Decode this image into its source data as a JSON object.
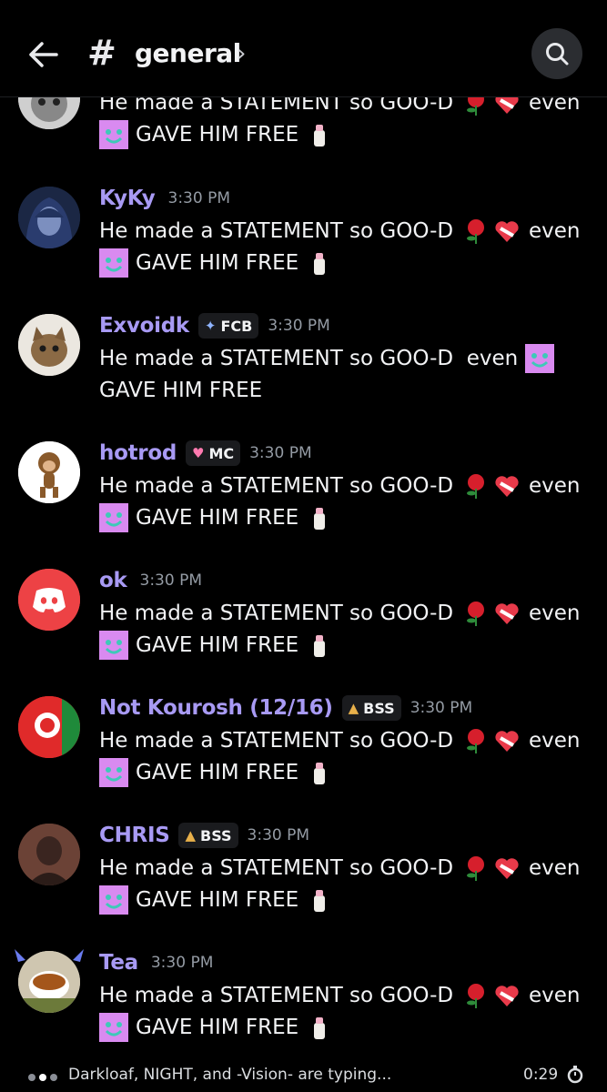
{
  "header": {
    "channel_name": "general",
    "hash": "#",
    "chevron": "›",
    "icons": [
      "back-arrow-icon",
      "search-icon"
    ]
  },
  "message_text": {
    "line1": "He made a STATEMENT so GOO-D",
    "even": "even",
    "line2": "GAVE HIM FREE",
    "alt_line1": "He made a STATEMENT so GOO-D  even",
    "alt_line2": "GAVE HIM FREE"
  },
  "messages": [
    {
      "username": "",
      "tag": "",
      "time": ""
    },
    {
      "username": "KyKy",
      "tag": "",
      "time": "3:30 PM"
    },
    {
      "username": "Exvoidk",
      "tag": "FCB",
      "time": "3:30 PM"
    },
    {
      "username": "hotrod",
      "tag": "MC",
      "time": "3:30 PM"
    },
    {
      "username": "ok",
      "tag": "",
      "time": "3:30 PM"
    },
    {
      "username": "Not Kourosh (12/16)",
      "tag": "BSS",
      "time": "3:30 PM"
    },
    {
      "username": "CHRIS",
      "tag": "BSS",
      "time": "3:30 PM"
    },
    {
      "username": "Tea",
      "tag": "",
      "time": "3:30 PM"
    }
  ],
  "typing": {
    "text": "Darkloaf, NIGHT, and -Vision- are typing...",
    "timer": "0:29"
  },
  "colors": {
    "background": "#000000",
    "username": "#a89af4",
    "timestamp": "#949ba4",
    "discord_red": "#ed4245"
  }
}
